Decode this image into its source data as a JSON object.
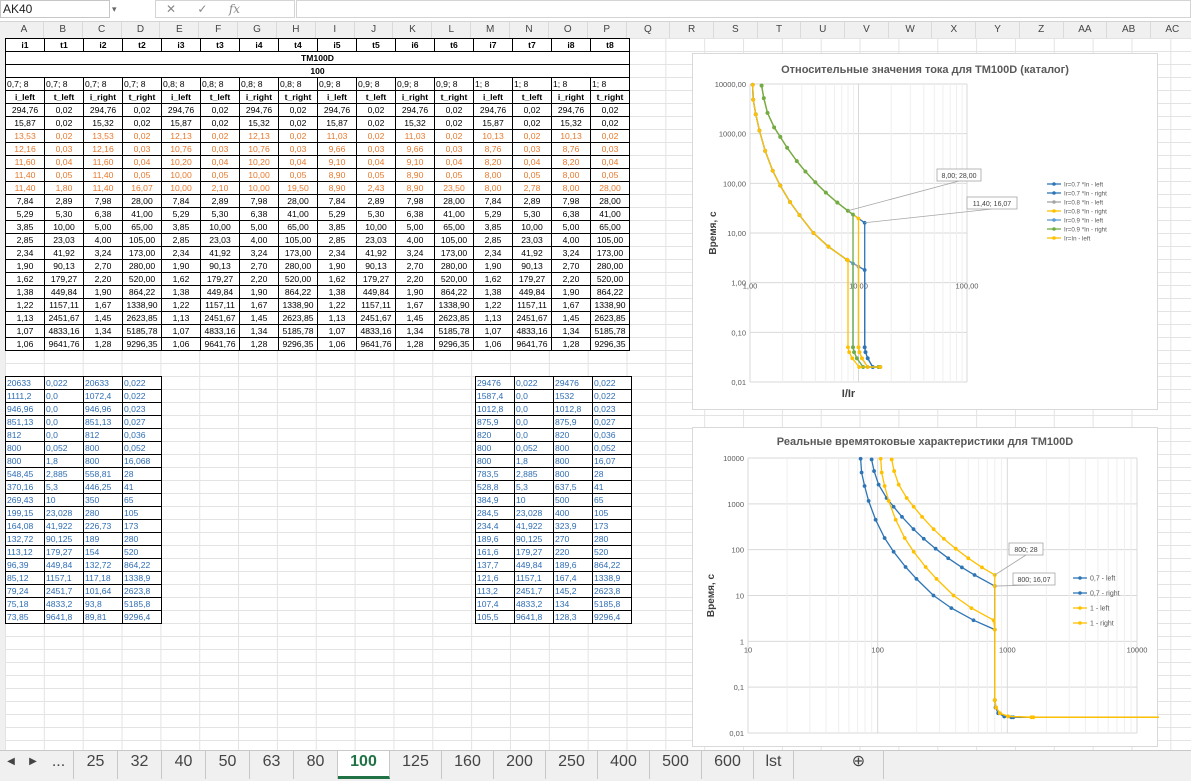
{
  "formula_bar": {
    "name_box": "AK40",
    "fx_label": "fx",
    "name_dropdown": "▾",
    "fx_cancel": "✕",
    "fx_enter": "✓"
  },
  "columns": [
    "A",
    "B",
    "C",
    "D",
    "E",
    "F",
    "G",
    "H",
    "I",
    "J",
    "K",
    "L",
    "M",
    "N",
    "O",
    "P",
    "Q",
    "R",
    "S",
    "T",
    "U",
    "V",
    "W",
    "X",
    "Y",
    "Z",
    "AA",
    "AB",
    "AC"
  ],
  "main_table": {
    "title": "TM100D",
    "current": "100",
    "header": [
      "i1",
      "t1",
      "i2",
      "t2",
      "i3",
      "t3",
      "i4",
      "t4",
      "i5",
      "t5",
      "i6",
      "t6",
      "i7",
      "t7",
      "i8",
      "t8"
    ],
    "ratio_row": [
      "0,7; 8",
      "0,7; 8",
      "0,7; 8",
      "0,7; 8",
      "0,8; 8",
      "0,8; 8",
      "0,8; 8",
      "0,8; 8",
      "0,9; 8",
      "0,9; 8",
      "0,9; 8",
      "0,9; 8",
      "1; 8",
      "1; 8",
      "1; 8",
      "1; 8"
    ],
    "sub_header": [
      "i_left",
      "t_left",
      "i_right",
      "t_right",
      "i_left",
      "t_left",
      "i_right",
      "t_right",
      "i_left",
      "t_left",
      "i_right",
      "t_right",
      "i_left",
      "t_left",
      "i_right",
      "t_right"
    ],
    "rows": [
      [
        "294,76",
        "0,02",
        "294,76",
        "0,02",
        "294,76",
        "0,02",
        "294,76",
        "0,02",
        "294,76",
        "0,02",
        "294,76",
        "0,02",
        "294,76",
        "0,02",
        "294,76",
        "0,02"
      ],
      [
        "15,87",
        "0,02",
        "15,32",
        "0,02",
        "15,87",
        "0,02",
        "15,32",
        "0,02",
        "15,87",
        "0,02",
        "15,32",
        "0,02",
        "15,87",
        "0,02",
        "15,32",
        "0,02"
      ],
      [
        "13,53",
        "0,02",
        "13,53",
        "0,02",
        "12,13",
        "0,02",
        "12,13",
        "0,02",
        "11,03",
        "0,02",
        "11,03",
        "0,02",
        "10,13",
        "0,02",
        "10,13",
        "0,02"
      ],
      [
        "12,16",
        "0,03",
        "12,16",
        "0,03",
        "10,76",
        "0,03",
        "10,76",
        "0,03",
        "9,66",
        "0,03",
        "9,66",
        "0,03",
        "8,76",
        "0,03",
        "8,76",
        "0,03"
      ],
      [
        "11,60",
        "0,04",
        "11,60",
        "0,04",
        "10,20",
        "0,04",
        "10,20",
        "0,04",
        "9,10",
        "0,04",
        "9,10",
        "0,04",
        "8,20",
        "0,04",
        "8,20",
        "0,04"
      ],
      [
        "11,40",
        "0,05",
        "11,40",
        "0,05",
        "10,00",
        "0,05",
        "10,00",
        "0,05",
        "8,90",
        "0,05",
        "8,90",
        "0,05",
        "8,00",
        "0,05",
        "8,00",
        "0,05"
      ],
      [
        "11,40",
        "1,80",
        "11,40",
        "16,07",
        "10,00",
        "2,10",
        "10,00",
        "19,50",
        "8,90",
        "2,43",
        "8,90",
        "23,50",
        "8,00",
        "2,78",
        "8,00",
        "28,00"
      ],
      [
        "7,84",
        "2,89",
        "7,98",
        "28,00",
        "7,84",
        "2,89",
        "7,98",
        "28,00",
        "7,84",
        "2,89",
        "7,98",
        "28,00",
        "7,84",
        "2,89",
        "7,98",
        "28,00"
      ],
      [
        "5,29",
        "5,30",
        "6,38",
        "41,00",
        "5,29",
        "5,30",
        "6,38",
        "41,00",
        "5,29",
        "5,30",
        "6,38",
        "41,00",
        "5,29",
        "5,30",
        "6,38",
        "41,00"
      ],
      [
        "3,85",
        "10,00",
        "5,00",
        "65,00",
        "3,85",
        "10,00",
        "5,00",
        "65,00",
        "3,85",
        "10,00",
        "5,00",
        "65,00",
        "3,85",
        "10,00",
        "5,00",
        "65,00"
      ],
      [
        "2,85",
        "23,03",
        "4,00",
        "105,00",
        "2,85",
        "23,03",
        "4,00",
        "105,00",
        "2,85",
        "23,03",
        "4,00",
        "105,00",
        "2,85",
        "23,03",
        "4,00",
        "105,00"
      ],
      [
        "2,34",
        "41,92",
        "3,24",
        "173,00",
        "2,34",
        "41,92",
        "3,24",
        "173,00",
        "2,34",
        "41,92",
        "3,24",
        "173,00",
        "2,34",
        "41,92",
        "3,24",
        "173,00"
      ],
      [
        "1,90",
        "90,13",
        "2,70",
        "280,00",
        "1,90",
        "90,13",
        "2,70",
        "280,00",
        "1,90",
        "90,13",
        "2,70",
        "280,00",
        "1,90",
        "90,13",
        "2,70",
        "280,00"
      ],
      [
        "1,62",
        "179,27",
        "2,20",
        "520,00",
        "1,62",
        "179,27",
        "2,20",
        "520,00",
        "1,62",
        "179,27",
        "2,20",
        "520,00",
        "1,62",
        "179,27",
        "2,20",
        "520,00"
      ],
      [
        "1,38",
        "449,84",
        "1,90",
        "864,22",
        "1,38",
        "449,84",
        "1,90",
        "864,22",
        "1,38",
        "449,84",
        "1,90",
        "864,22",
        "1,38",
        "449,84",
        "1,90",
        "864,22"
      ],
      [
        "1,22",
        "1157,11",
        "1,67",
        "1338,90",
        "1,22",
        "1157,11",
        "1,67",
        "1338,90",
        "1,22",
        "1157,11",
        "1,67",
        "1338,90",
        "1,22",
        "1157,11",
        "1,67",
        "1338,90"
      ],
      [
        "1,13",
        "2451,67",
        "1,45",
        "2623,85",
        "1,13",
        "2451,67",
        "1,45",
        "2623,85",
        "1,13",
        "2451,67",
        "1,45",
        "2623,85",
        "1,13",
        "2451,67",
        "1,45",
        "2623,85"
      ],
      [
        "1,07",
        "4833,16",
        "1,34",
        "5185,78",
        "1,07",
        "4833,16",
        "1,34",
        "5185,78",
        "1,07",
        "4833,16",
        "1,34",
        "5185,78",
        "1,07",
        "4833,16",
        "1,34",
        "5185,78"
      ],
      [
        "1,06",
        "9641,76",
        "1,28",
        "9296,35",
        "1,06",
        "9641,76",
        "1,28",
        "9296,35",
        "1,06",
        "9641,76",
        "1,28",
        "9296,35",
        "1,06",
        "9641,76",
        "1,28",
        "9296,35"
      ]
    ]
  },
  "small_table_left": [
    [
      "20633",
      "0,022",
      "20633",
      "0,022"
    ],
    [
      "1111,2",
      "0,0",
      "1072,4",
      "0,022"
    ],
    [
      "946,96",
      "0,0",
      "946,96",
      "0,023"
    ],
    [
      "851,13",
      "0,0",
      "851,13",
      "0,027"
    ],
    [
      "812",
      "0,0",
      "812",
      "0,036"
    ],
    [
      "800",
      "0,052",
      "800",
      "0,052"
    ],
    [
      "800",
      "1,8",
      "800",
      "16,068"
    ],
    [
      "548,45",
      "2,885",
      "558,81",
      "28"
    ],
    [
      "370,16",
      "5,3",
      "446,25",
      "41"
    ],
    [
      "269,43",
      "10",
      "350",
      "65"
    ],
    [
      "199,15",
      "23,028",
      "280",
      "105"
    ],
    [
      "164,08",
      "41,922",
      "226,73",
      "173"
    ],
    [
      "132,72",
      "90,125",
      "189",
      "280"
    ],
    [
      "113,12",
      "179,27",
      "154",
      "520"
    ],
    [
      "96,39",
      "449,84",
      "132,72",
      "864,22"
    ],
    [
      "85,12",
      "1157,1",
      "117,18",
      "1338,9"
    ],
    [
      "79,24",
      "2451,7",
      "101,64",
      "2623,8"
    ],
    [
      "75,18",
      "4833,2",
      "93,8",
      "5185,8"
    ],
    [
      "73,85",
      "9641,8",
      "89,81",
      "9296,4"
    ]
  ],
  "small_table_right": [
    [
      "29476",
      "0,022",
      "29476",
      "0,022"
    ],
    [
      "1587,4",
      "0,0",
      "1532",
      "0,022"
    ],
    [
      "1012,8",
      "0,0",
      "1012,8",
      "0,023"
    ],
    [
      "875,9",
      "0,0",
      "875,9",
      "0,027"
    ],
    [
      "820",
      "0,0",
      "820",
      "0,036"
    ],
    [
      "800",
      "0,052",
      "800",
      "0,052"
    ],
    [
      "800",
      "1,8",
      "800",
      "16,07"
    ],
    [
      "783,5",
      "2,885",
      "800",
      "28"
    ],
    [
      "528,8",
      "5,3",
      "637,5",
      "41"
    ],
    [
      "384,9",
      "10",
      "500",
      "65"
    ],
    [
      "284,5",
      "23,028",
      "400",
      "105"
    ],
    [
      "234,4",
      "41,922",
      "323,9",
      "173"
    ],
    [
      "189,6",
      "90,125",
      "270",
      "280"
    ],
    [
      "161,6",
      "179,27",
      "220",
      "520"
    ],
    [
      "137,7",
      "449,84",
      "189,6",
      "864,22"
    ],
    [
      "121,6",
      "1157,1",
      "167,4",
      "1338,9"
    ],
    [
      "113,2",
      "2451,7",
      "145,2",
      "2623,8"
    ],
    [
      "107,4",
      "4833,2",
      "134",
      "5185,8"
    ],
    [
      "105,5",
      "9641,8",
      "128,3",
      "9296,4"
    ]
  ],
  "chart_data": [
    {
      "type": "scatter",
      "title": "Относительные значения тока для TM100D (каталог)",
      "xlabel": "I/Ir",
      "ylabel": "Время, с",
      "x_scale": "log",
      "y_scale": "log",
      "xlim": [
        1,
        100
      ],
      "ylim": [
        0.01,
        10000
      ],
      "x_ticks": [
        "1,00",
        "10,00",
        "100,00"
      ],
      "y_ticks": [
        "10000,00",
        "1000,00",
        "100,00",
        "10,00",
        "1,00",
        "0,10",
        "0,01"
      ],
      "annotations": [
        "8,00; 28,00",
        "11,40; 16,07"
      ],
      "series": [
        {
          "name": "Ir=0.7 *In - left",
          "color": "#2e75b6",
          "x": [
            1.06,
            1.07,
            1.13,
            1.22,
            1.38,
            1.62,
            1.9,
            2.34,
            2.85,
            3.85,
            5.29,
            7.84,
            11.4,
            11.4,
            11.6,
            12.16,
            13.53,
            15.87
          ],
          "y": [
            9641.76,
            4833.16,
            2451.67,
            1157.11,
            449.84,
            179.27,
            90.13,
            41.92,
            23.03,
            10,
            5.3,
            2.89,
            1.8,
            0.05,
            0.04,
            0.03,
            0.02,
            0.02
          ]
        },
        {
          "name": "Ir=0.7 *In - right",
          "color": "#2e75b6",
          "x": [
            1.28,
            1.34,
            1.45,
            1.67,
            1.9,
            2.2,
            2.7,
            3.24,
            4,
            5,
            6.38,
            7.98,
            11.4,
            11.4,
            11.6,
            12.16,
            13.53,
            15.32
          ],
          "y": [
            9296.35,
            5185.78,
            2623.85,
            1338.9,
            864.22,
            520,
            280,
            173,
            105,
            65,
            41,
            28,
            16.07,
            0.05,
            0.04,
            0.03,
            0.02,
            0.02
          ]
        },
        {
          "name": "Ir=0.8 *In - left",
          "color": "#a5a5a5",
          "x": [
            1.06,
            1.07,
            1.13,
            1.22,
            1.38,
            1.62,
            1.9,
            2.34,
            2.85,
            3.85,
            5.29,
            7.84,
            10,
            10,
            10.2,
            10.76,
            12.13,
            15.87
          ],
          "y": [
            9641.76,
            4833.16,
            2451.67,
            1157.11,
            449.84,
            179.27,
            90.13,
            41.92,
            23.03,
            10,
            5.3,
            2.89,
            2.1,
            0.05,
            0.04,
            0.03,
            0.02,
            0.02
          ]
        },
        {
          "name": "Ir=0.8 *In - right",
          "color": "#ffc000",
          "x": [
            1.28,
            1.34,
            1.45,
            1.67,
            1.9,
            2.2,
            2.7,
            3.24,
            4,
            5,
            6.38,
            7.98,
            10,
            10,
            10.2,
            10.76,
            12.13,
            15.32
          ],
          "y": [
            9296.35,
            5185.78,
            2623.85,
            1338.9,
            864.22,
            520,
            280,
            173,
            105,
            65,
            41,
            28,
            19.5,
            0.05,
            0.04,
            0.03,
            0.02,
            0.02
          ]
        },
        {
          "name": "Ir=0.9 *In - left",
          "color": "#5b9bd5",
          "x": [
            1.06,
            1.07,
            1.13,
            1.22,
            1.38,
            1.62,
            1.9,
            2.34,
            2.85,
            3.85,
            5.29,
            7.84,
            8.9,
            8.9,
            9.1,
            9.66,
            11.03,
            15.87
          ],
          "y": [
            9641.76,
            4833.16,
            2451.67,
            1157.11,
            449.84,
            179.27,
            90.13,
            41.92,
            23.03,
            10,
            5.3,
            2.89,
            2.43,
            0.05,
            0.04,
            0.03,
            0.02,
            0.02
          ]
        },
        {
          "name": "Ir=0.9 *In - right",
          "color": "#70ad47",
          "x": [
            1.28,
            1.34,
            1.45,
            1.67,
            1.9,
            2.2,
            2.7,
            3.24,
            4,
            5,
            6.38,
            7.98,
            8.9,
            8.9,
            9.1,
            9.66,
            11.03,
            15.32
          ],
          "y": [
            9296.35,
            5185.78,
            2623.85,
            1338.9,
            864.22,
            520,
            280,
            173,
            105,
            65,
            41,
            28,
            23.5,
            0.05,
            0.04,
            0.03,
            0.02,
            0.02
          ]
        },
        {
          "name": "Ir=In - left",
          "color": "#ffc000",
          "x": [
            1.06,
            1.07,
            1.13,
            1.22,
            1.38,
            1.62,
            1.9,
            2.34,
            2.85,
            3.85,
            5.29,
            7.84,
            8,
            8,
            8.2,
            8.76,
            10.13,
            15.87
          ],
          "y": [
            9641.76,
            4833.16,
            2451.67,
            1157.11,
            449.84,
            179.27,
            90.13,
            41.92,
            23.03,
            10,
            5.3,
            2.89,
            2.78,
            0.05,
            0.04,
            0.03,
            0.02,
            0.02
          ]
        }
      ]
    },
    {
      "type": "scatter",
      "title": "Реальные времятоковые характеристики для TM100D",
      "xlabel": "",
      "ylabel": "Время, с",
      "x_scale": "log",
      "y_scale": "log",
      "xlim": [
        10,
        10000
      ],
      "ylim": [
        0.01,
        10000
      ],
      "x_ticks": [
        "10",
        "100",
        "1000",
        "10000"
      ],
      "y_ticks": [
        "10000",
        "1000",
        "100",
        "10",
        "1",
        "0,1",
        "0,01"
      ],
      "annotations": [
        "800; 28",
        "800; 16,07"
      ],
      "series": [
        {
          "name": "0,7 - left",
          "color": "#2e75b6",
          "x": [
            73.85,
            75.18,
            79.24,
            85.12,
            96.39,
            113.12,
            132.72,
            164.08,
            199.15,
            269.43,
            370.16,
            548.45,
            800,
            800,
            812,
            851.13,
            946.96,
            1111.2,
            20633
          ],
          "y": [
            9641.8,
            4833.2,
            2451.7,
            1157.1,
            449.84,
            179.27,
            90.125,
            41.922,
            23.028,
            10,
            5.3,
            2.885,
            1.8,
            0.052,
            0.036,
            0.027,
            0.023,
            0.022,
            0.022
          ]
        },
        {
          "name": "0,7 - right",
          "color": "#2e75b6",
          "x": [
            89.81,
            93.8,
            101.64,
            117.18,
            132.72,
            154,
            189,
            226.73,
            280,
            350,
            446.25,
            558.81,
            800,
            800,
            812,
            851.13,
            946.96,
            1072.4,
            20633
          ],
          "y": [
            9296.4,
            5185.8,
            2623.8,
            1338.9,
            864.22,
            520,
            280,
            173,
            105,
            65,
            41,
            28,
            16.068,
            0.052,
            0.036,
            0.027,
            0.023,
            0.022,
            0.022
          ]
        },
        {
          "name": "1 - left",
          "color": "#ffc000",
          "x": [
            105.5,
            107.4,
            113.2,
            121.6,
            137.7,
            161.6,
            189.6,
            234.4,
            284.5,
            384.9,
            528.8,
            783.5,
            800,
            800,
            820,
            875.9,
            1012.8,
            1587.4,
            29476
          ],
          "y": [
            9641.8,
            4833.2,
            2451.7,
            1157.1,
            449.84,
            179.27,
            90.125,
            41.922,
            23.028,
            10,
            5.3,
            2.885,
            1.8,
            0.052,
            0.036,
            0.027,
            0.023,
            0.022,
            0.022
          ]
        },
        {
          "name": "1 - right",
          "color": "#ffc000",
          "x": [
            128.3,
            134,
            145.2,
            167.4,
            189.6,
            220,
            270,
            323.9,
            400,
            500,
            637.5,
            800,
            800,
            800,
            820,
            875.9,
            1012.8,
            1532,
            29476
          ],
          "y": [
            9296.4,
            5185.8,
            2623.8,
            1338.9,
            864.22,
            520,
            280,
            173,
            105,
            65,
            41,
            28,
            16.07,
            0.052,
            0.036,
            0.027,
            0.023,
            0.022,
            0.022
          ]
        }
      ]
    }
  ],
  "tabs": [
    "◀",
    "▶",
    "...",
    "25",
    "32",
    "40",
    "50",
    "63",
    "80",
    "100",
    "125",
    "160",
    "200",
    "250",
    "400",
    "500",
    "600",
    "lst",
    "⊕"
  ],
  "active_tab": "100"
}
